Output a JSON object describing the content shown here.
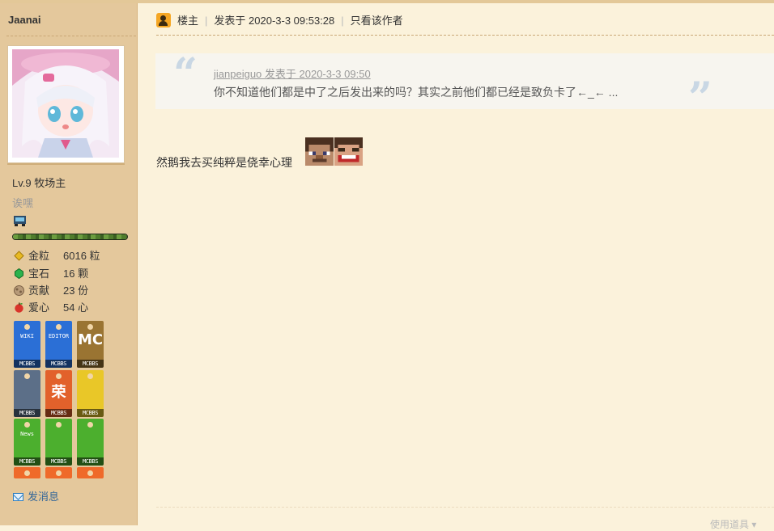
{
  "sidebar": {
    "username": "Jaanai",
    "level": "Lv.9 牧场主",
    "custom_title": "诶嘿",
    "exp_progress": 1.0,
    "stats": [
      {
        "icon": "gold-nugget-icon",
        "label": "金粒",
        "value": "6016 粒",
        "color": "#e8b923"
      },
      {
        "icon": "emerald-icon",
        "label": "宝石",
        "value": "16 颗",
        "color": "#2bb24c"
      },
      {
        "icon": "contribution-icon",
        "label": "贡献",
        "value": "23 份",
        "color": "#a98a6a"
      },
      {
        "icon": "apple-icon",
        "label": "爱心",
        "value": "54 心",
        "color": "#d9342b"
      }
    ],
    "medals": [
      {
        "name": "wiki-medal",
        "top": "WIKI",
        "footer": "MCBBS",
        "color": "#2b6fd6"
      },
      {
        "name": "editor-medal",
        "top": "EDITOR",
        "footer": "MCBBS",
        "color": "#2b6fd6"
      },
      {
        "name": "document-medal",
        "top": "MC",
        "footer": "MCBBS",
        "color": "#9a7432"
      },
      {
        "name": "bread-medal",
        "top": "",
        "footer": "MCBBS",
        "color": "#5c6f88"
      },
      {
        "name": "honor-medal",
        "top": "荣",
        "footer": "MCBBS",
        "color": "#e2612b"
      },
      {
        "name": "villager-medal",
        "top": "",
        "footer": "MCBBS",
        "color": "#e9c728"
      },
      {
        "name": "news-medal",
        "top": "News",
        "footer": "MCBBS",
        "color": "#4caf2e"
      },
      {
        "name": "book-medal",
        "top": "",
        "footer": "MCBBS",
        "color": "#4caf2e"
      },
      {
        "name": "no-mob-medal",
        "top": "",
        "footer": "MCBBS",
        "color": "#4caf2e"
      }
    ],
    "send_message": "发消息"
  },
  "post": {
    "host_label": "楼主",
    "posted_at": "发表于 2020-3-3 09:53:28",
    "only_author": "只看该作者",
    "quote": {
      "author": "jianpeiguo 发表于 2020-3-3 09:50",
      "text": "你不知道他们都是中了之后发出来的吗？其实之前他们都已经是致负卡了←_← ...",
      "open_mark": "“",
      "close_mark": "”"
    },
    "body": "然鹅我去买纯粹是侥幸心理",
    "emojis": [
      "steve-face-icon",
      "laughing-face-icon"
    ],
    "use_item": "使用道具 ▾"
  }
}
